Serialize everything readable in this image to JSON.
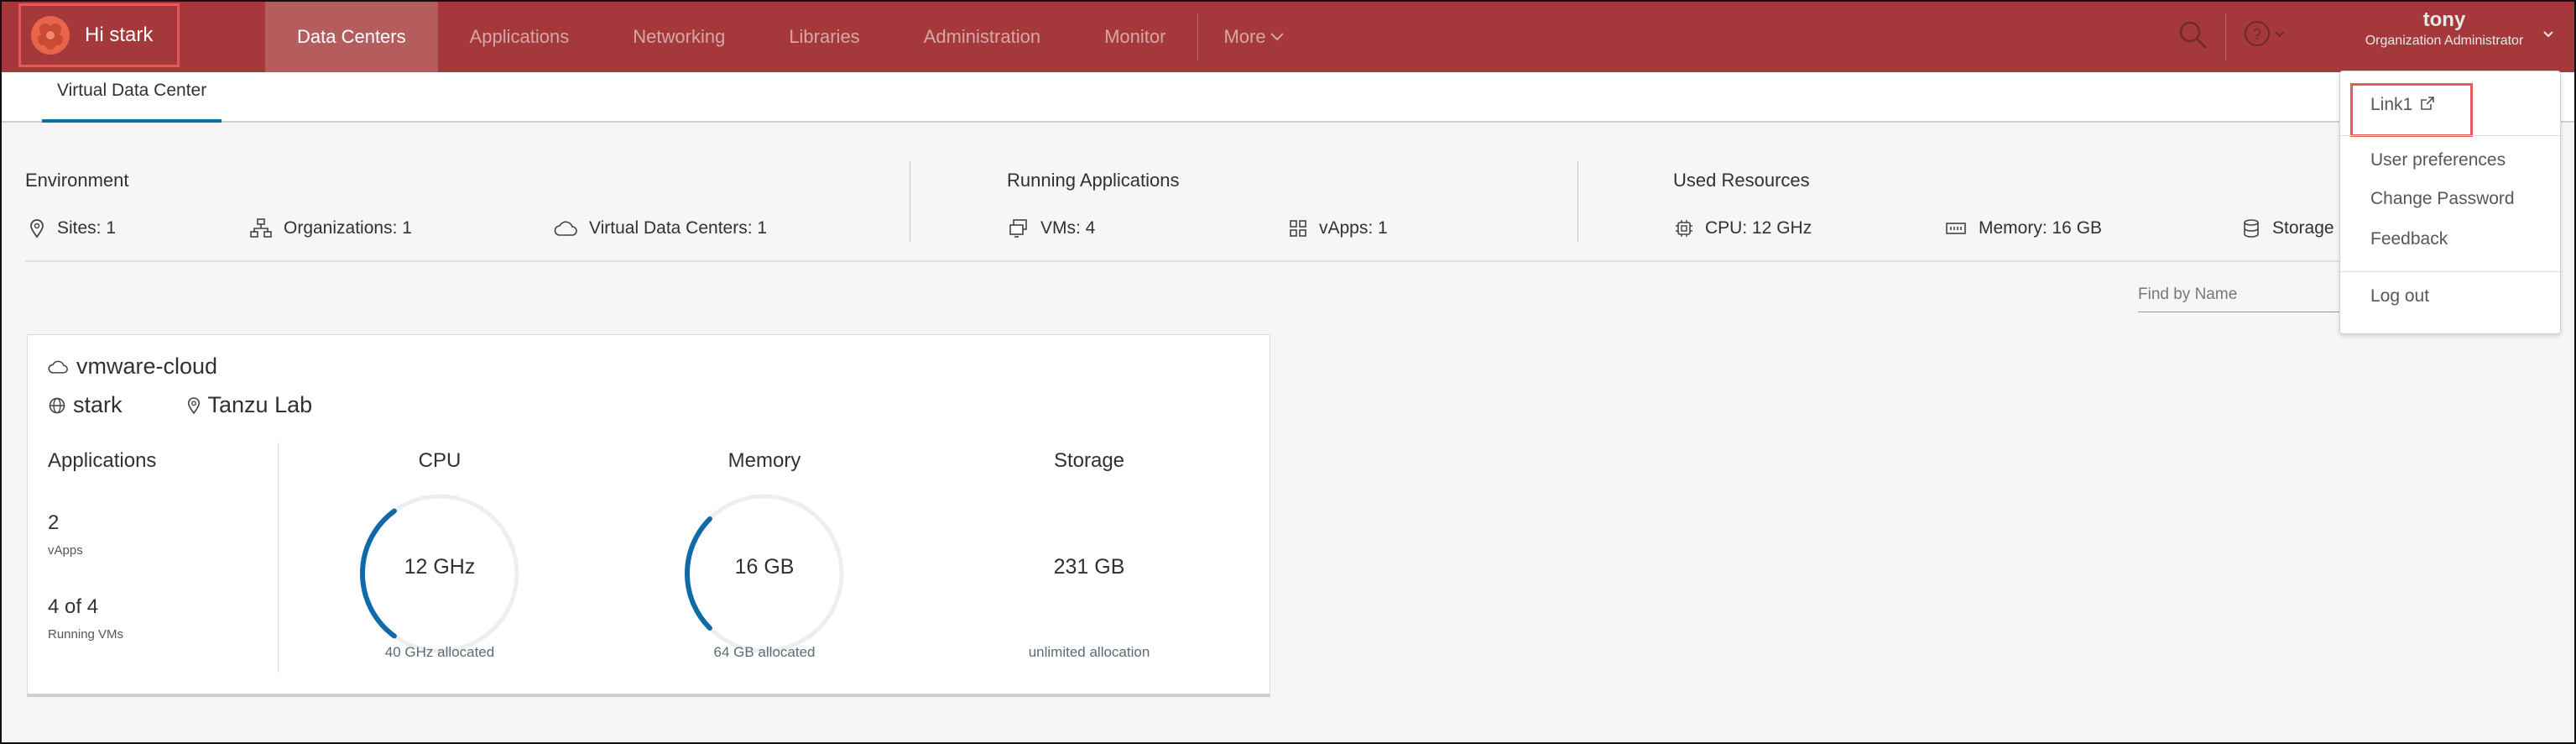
{
  "header": {
    "greeting": "Hi stark",
    "nav": [
      "Data Centers",
      "Applications",
      "Networking",
      "Libraries",
      "Administration",
      "Monitor"
    ],
    "more_label": "More",
    "user_name": "tony",
    "user_role": "Organization Administrator",
    "accent_color": "#a5383a"
  },
  "subtabs": [
    "Virtual Data Center"
  ],
  "summary": {
    "environment": {
      "title": "Environment",
      "sites": "Sites:  1",
      "organizations": "Organizations:  1",
      "vdcs": "Virtual Data Centers:  1"
    },
    "running": {
      "title": "Running Applications",
      "vms": "VMs:  4",
      "vapps": "vApps:  1"
    },
    "resources": {
      "title": "Used Resources",
      "cpu": "CPU:  12 GHz",
      "memory": "Memory:  16 GB",
      "storage": "Storage"
    }
  },
  "search": {
    "placeholder": "Find by Name"
  },
  "card": {
    "name": "vmware-cloud",
    "org": "stark",
    "site": "Tanzu Lab",
    "applications_title": "Applications",
    "vapps_count": "2",
    "vapps_label": "vApps",
    "vms_count": "4 of 4",
    "vms_label": "Running VMs",
    "cpu": {
      "title": "CPU",
      "value": "12 GHz",
      "allocated": "40 GHz allocated",
      "fraction": 0.3
    },
    "memory": {
      "title": "Memory",
      "value": "16 GB",
      "allocated": "64 GB allocated",
      "fraction": 0.25
    },
    "storage": {
      "title": "Storage",
      "value": "231 GB",
      "allocated": "unlimited allocation"
    }
  },
  "user_menu": {
    "link1": "Link1",
    "preferences": "User preferences",
    "change_password": "Change Password",
    "feedback": "Feedback",
    "logout": "Log out"
  }
}
